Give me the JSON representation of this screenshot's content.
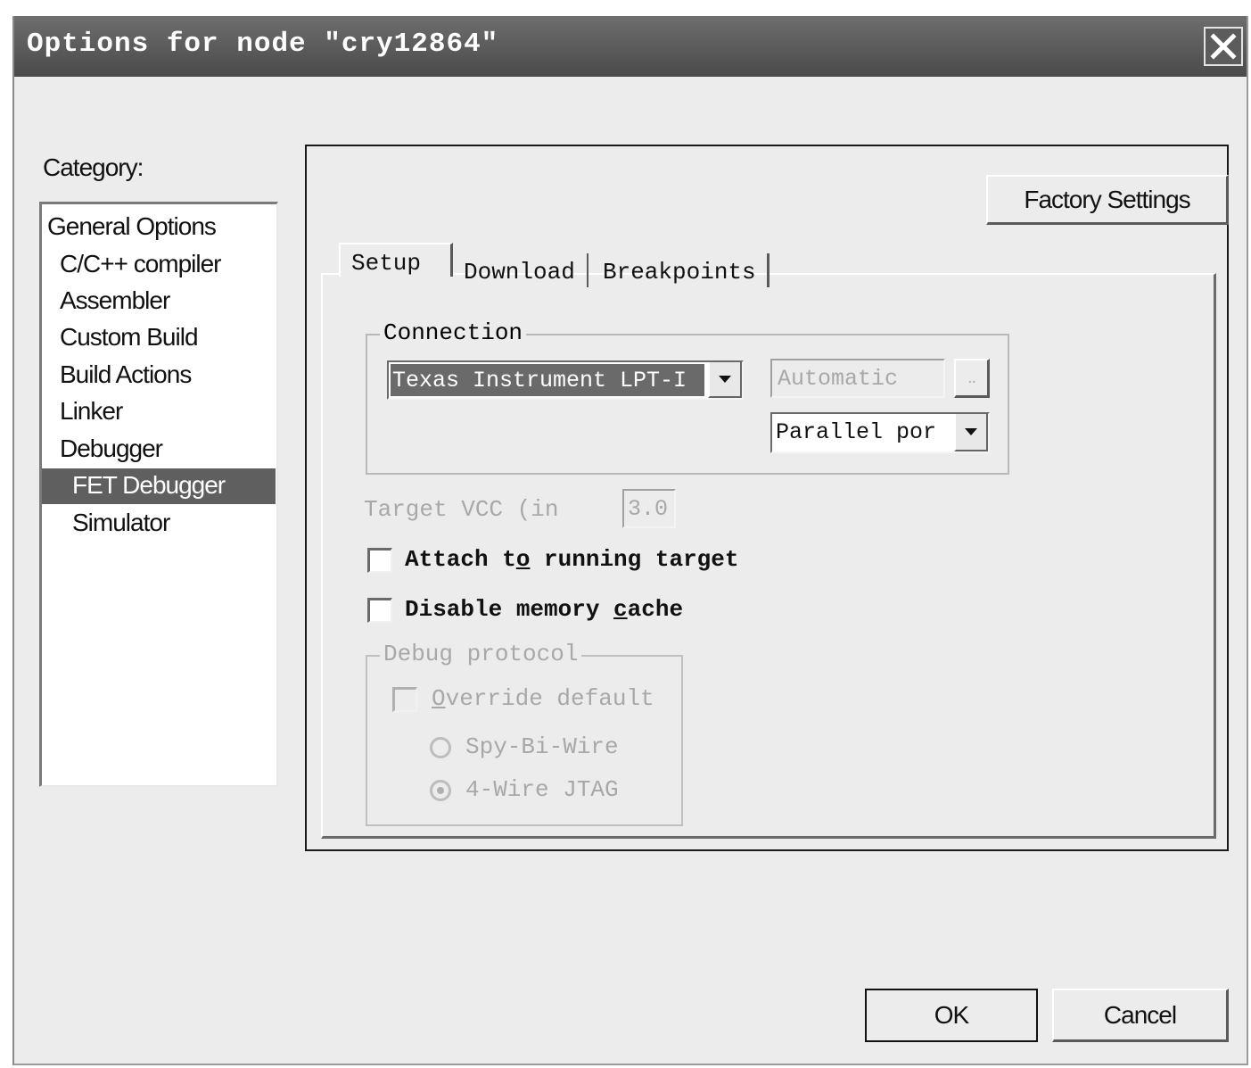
{
  "window": {
    "title": "Options for node \"cry12864\""
  },
  "category": {
    "label": "Category:",
    "items": [
      {
        "label": "General Options"
      },
      {
        "label": "C/C++ compiler"
      },
      {
        "label": "Assembler"
      },
      {
        "label": "Custom Build"
      },
      {
        "label": "Build Actions"
      },
      {
        "label": "Linker"
      },
      {
        "label": "Debugger"
      },
      {
        "label": "FET Debugger"
      },
      {
        "label": "Simulator"
      }
    ],
    "selected": "FET Debugger"
  },
  "panel": {
    "factory_settings_label": "Factory Settings",
    "tabs": [
      {
        "label": "Setup"
      },
      {
        "label": "Download"
      },
      {
        "label": "Breakpoints"
      }
    ],
    "active_tab": "Setup",
    "connection": {
      "title": "Connection",
      "driver_value": "Texas Instrument LPT-I",
      "port_value": "Automatic",
      "browse_label": "..",
      "interface_value": "Parallel por"
    },
    "target_vcc": {
      "label": "Target VCC (in",
      "value": "3.0"
    },
    "attach_running": {
      "label_before": "Attach t",
      "label_accel": "o",
      "label_after": " running target",
      "checked": false
    },
    "disable_cache": {
      "label_before": "Disable memory ",
      "label_accel": "c",
      "label_after": "ache",
      "checked": false
    },
    "debug_protocol": {
      "title": "Debug protocol",
      "override_before": "",
      "override_accel": "O",
      "override_after": "verride default",
      "override_checked": false,
      "options": [
        {
          "label": "Spy-Bi-Wire",
          "selected": false
        },
        {
          "label": "4-Wire JTAG",
          "selected": true
        }
      ]
    }
  },
  "buttons": {
    "ok_label": "OK",
    "cancel_label": "Cancel"
  }
}
